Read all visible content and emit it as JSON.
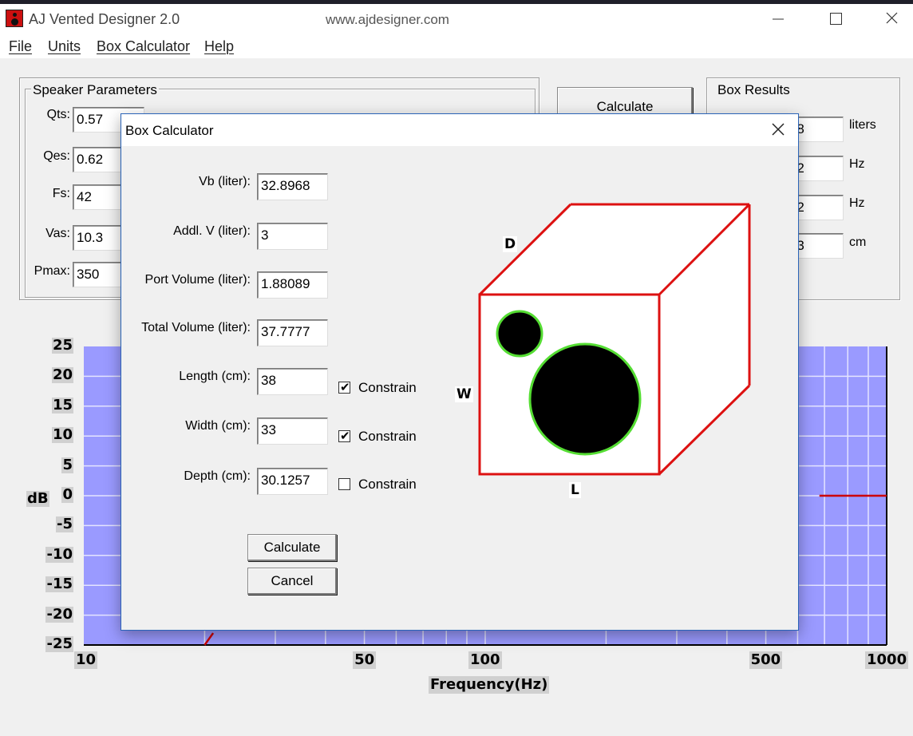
{
  "window": {
    "app_title": "AJ Vented Designer 2.0",
    "url": "www.ajdesigner.com"
  },
  "menu": [
    "File",
    "Units",
    "Box Calculator",
    "Help"
  ],
  "speaker_params": {
    "title": "Speaker Parameters",
    "fields": [
      {
        "label": "Qts:",
        "value": "0.57"
      },
      {
        "label": "Qes:",
        "value": "0.62"
      },
      {
        "label": "Fs:",
        "value": "42"
      },
      {
        "label": "Vas:",
        "value": "10.3"
      },
      {
        "label": "Pmax:",
        "value": "350"
      }
    ]
  },
  "main_calculate_label": "Calculate",
  "box_results": {
    "title": "Box Results",
    "rows": [
      {
        "value": "3968",
        "unit": "liters"
      },
      {
        "value": "3032",
        "unit": "Hz"
      },
      {
        "value": "3972",
        "unit": "Hz"
      },
      {
        "value": "2443",
        "unit": "cm"
      }
    ]
  },
  "chart_data": {
    "type": "line",
    "ylabel": "dB",
    "xlabel": "Frequency(Hz)",
    "xscale": "log",
    "xlim": [
      10,
      1000
    ],
    "ylim": [
      -25,
      25
    ],
    "y_ticks": [
      "25",
      "20",
      "15",
      "10",
      "5",
      "0",
      "-5",
      "-10",
      "-15",
      "-20",
      "-25"
    ],
    "x_ticks": [
      "10",
      "50",
      "100",
      "500",
      "1000"
    ],
    "grid": true,
    "line_color": "#cc0000",
    "background_color": "#9a9aff",
    "series": [
      {
        "x": [
          20,
          21
        ],
        "y": [
          -25,
          -23
        ]
      },
      {
        "x": [
          680,
          1000
        ],
        "y": [
          0,
          0
        ]
      }
    ]
  },
  "dialog": {
    "title": "Box Calculator",
    "fields": [
      {
        "label": "Vb (liter):",
        "value": "32.8968"
      },
      {
        "label": "Addl. V (liter):",
        "value": "3"
      },
      {
        "label": "Port Volume (liter):",
        "value": "1.88089"
      },
      {
        "label": "Total Volume (liter):",
        "value": "37.7777"
      },
      {
        "label": "Length (cm):",
        "value": "38"
      },
      {
        "label": "Width (cm):",
        "value": "33"
      },
      {
        "label": "Depth (cm):",
        "value": "30.1257"
      }
    ],
    "constrain_label": "Constrain",
    "constraints": {
      "length": true,
      "width": true,
      "depth": false
    },
    "calculate_label": "Calculate",
    "cancel_label": "Cancel",
    "box_labels": {
      "d": "D",
      "w": "W",
      "l": "L"
    }
  }
}
